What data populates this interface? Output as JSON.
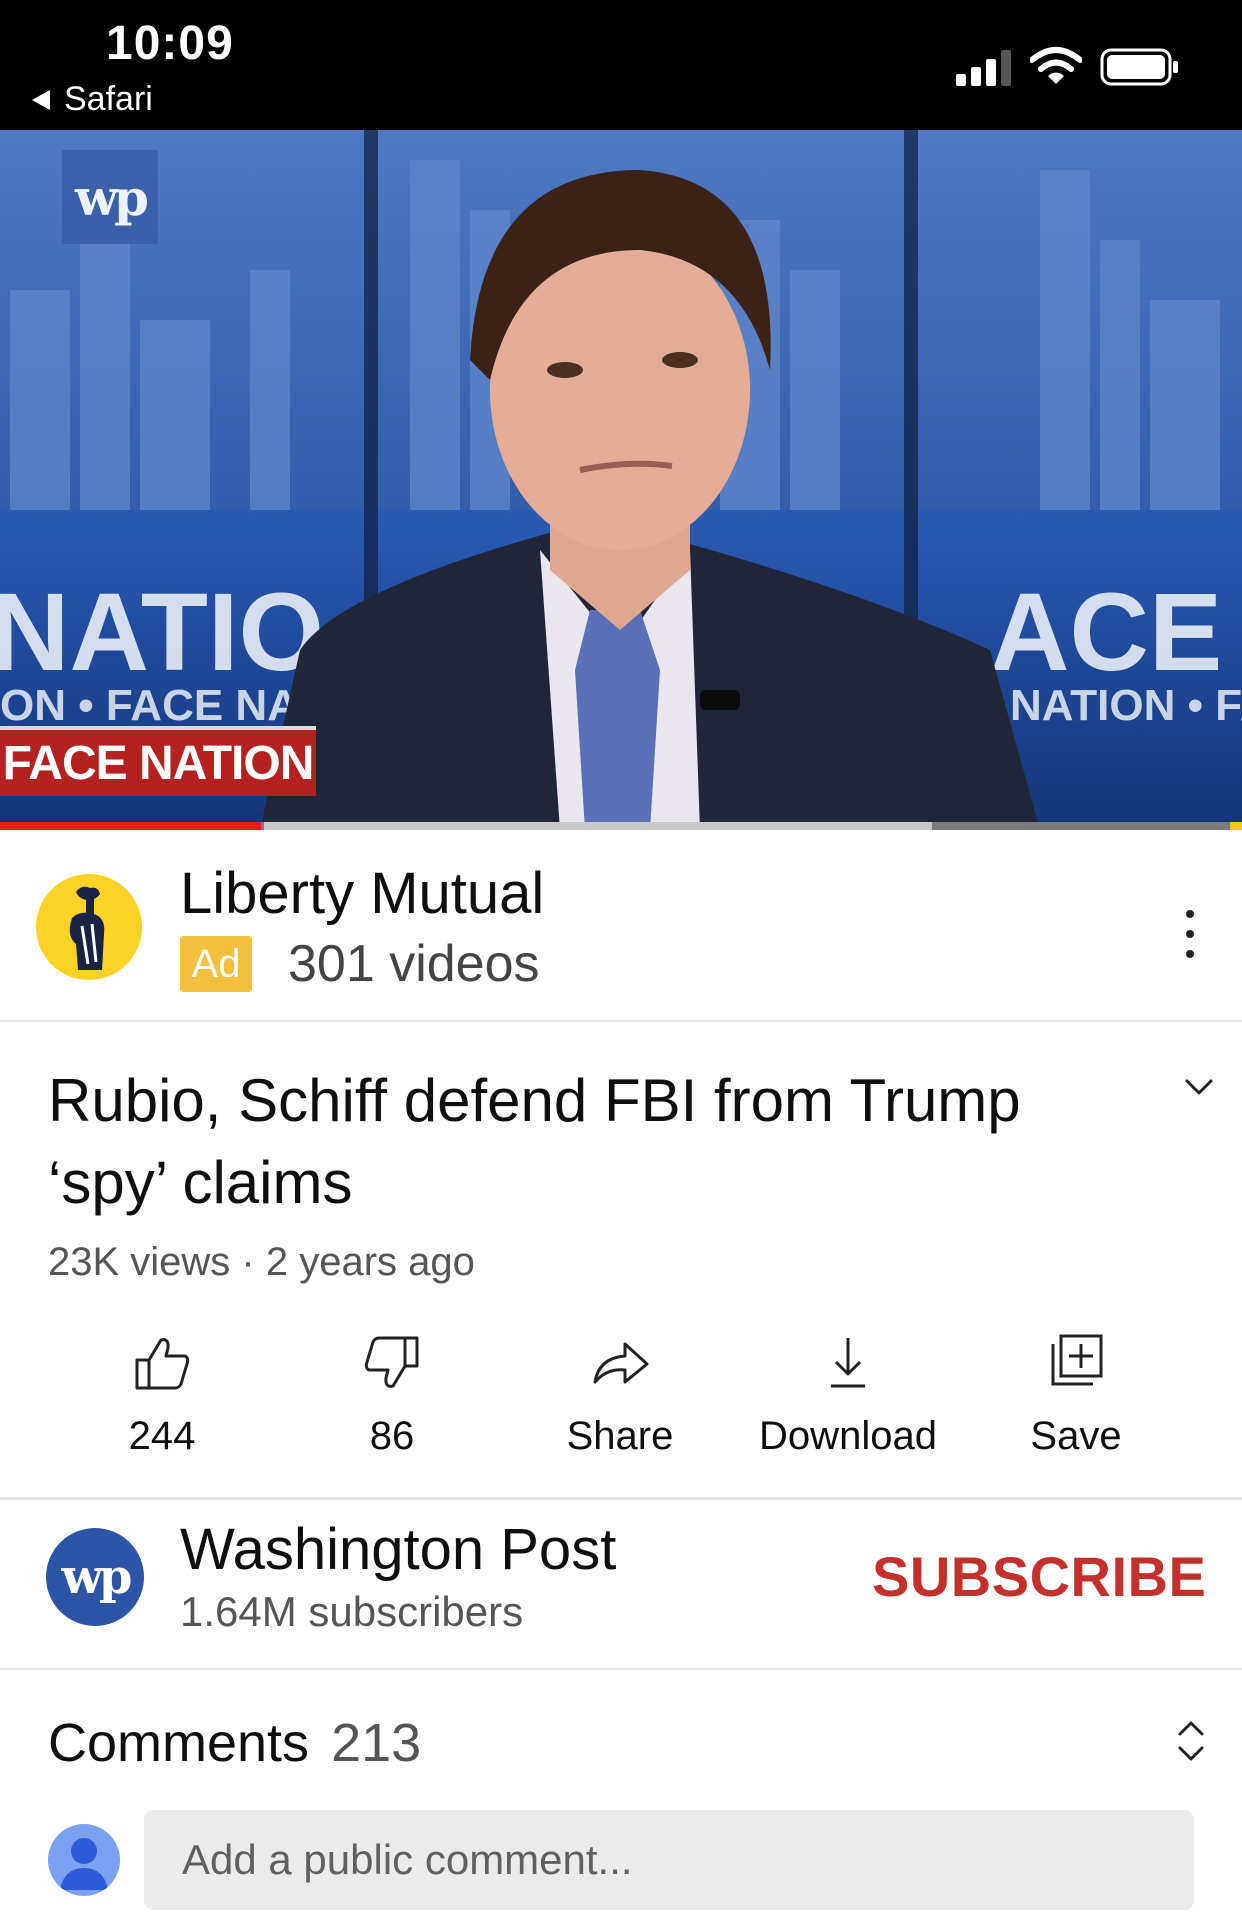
{
  "status_bar": {
    "time": "10:09",
    "back_app": "Safari"
  },
  "video": {
    "logo_text": "wp",
    "lower_third": "FACE NATION",
    "progress_played_fraction": 0.21
  },
  "ad": {
    "advertiser": "Liberty Mutual",
    "badge": "Ad",
    "videos": "301 videos"
  },
  "video_info": {
    "title": "Rubio, Schiff defend FBI from Trump ‘spy’ claims",
    "meta": "23K views · 2 years ago"
  },
  "actions": [
    {
      "label": "244",
      "icon": "thumbs-up-icon"
    },
    {
      "label": "86",
      "icon": "thumbs-down-icon"
    },
    {
      "label": "Share",
      "icon": "share-icon"
    },
    {
      "label": "Download",
      "icon": "download-icon"
    },
    {
      "label": "Save",
      "icon": "save-playlist-icon"
    }
  ],
  "channel": {
    "avatar_text": "wp",
    "name": "Washington Post",
    "subscribers": "1.64M subscribers",
    "subscribe_label": "SUBSCRIBE"
  },
  "comments": {
    "label": "Comments",
    "count": "213",
    "placeholder": "Add a public comment..."
  },
  "colors": {
    "subscribe": "#c4302b",
    "progress": "#e62117",
    "ad_badge": "#f2bf3e",
    "ad_logo_bg": "#fbd226"
  }
}
